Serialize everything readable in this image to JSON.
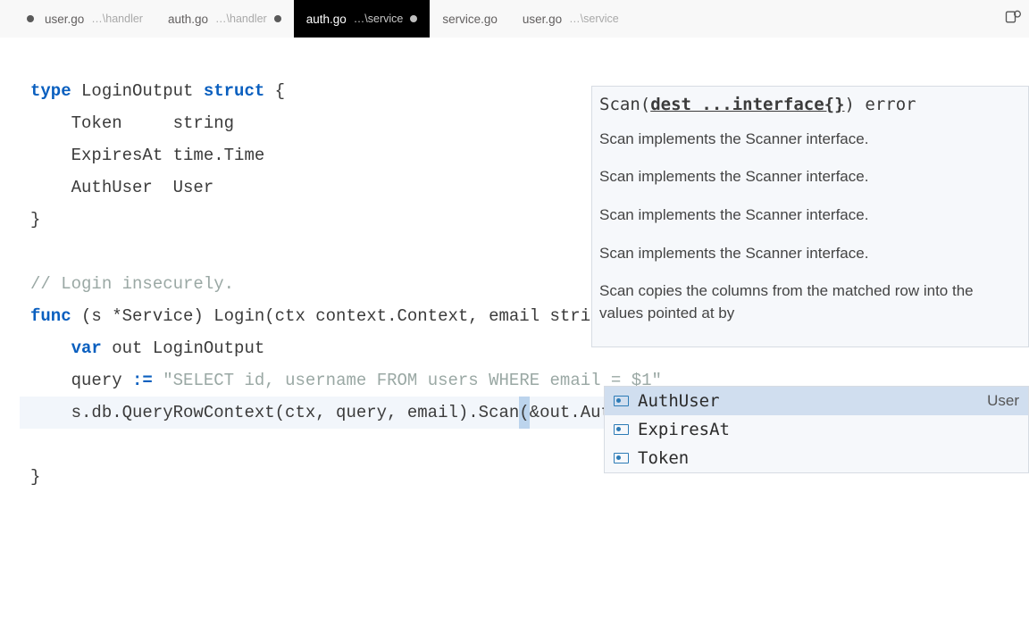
{
  "tabs": [
    {
      "name": "user.go",
      "path": "…\\handler",
      "modified": true,
      "active": false
    },
    {
      "name": "auth.go",
      "path": "…\\handler",
      "modified": true,
      "active": false
    },
    {
      "name": "auth.go",
      "path": "…\\service",
      "modified": true,
      "active": true
    },
    {
      "name": "service.go",
      "path": "",
      "modified": false,
      "active": false
    },
    {
      "name": "user.go",
      "path": "…\\service",
      "modified": false,
      "active": false
    }
  ],
  "code": {
    "l1_kw": "type",
    "l1_rest": " LoginOutput ",
    "l1_kw2": "struct",
    "l1_rest2": " {",
    "l2": "    Token     string",
    "l3": "    ExpiresAt time.Time",
    "l4": "    AuthUser  User",
    "l5": "}",
    "l6": "",
    "l7_cm": "// Login insecurely.",
    "l8_kw": "func",
    "l8_rest": " (s *Service) Login(ctx context.Context, email string) (Log",
    "l9a": "    ",
    "l9_kw": "var",
    "l9b": " out LoginOutput",
    "l10a": "    query ",
    "l10_op": ":=",
    "l10b": " ",
    "l10_str": "\"SELECT id, username FROM users WHERE email = $1\"",
    "l11a": "    s.db.QueryRowContext(ctx, query, email).Scan",
    "l11_p": "(",
    "l11b": "&out.AuthUser.ID, &out.",
    "l11c": ")",
    "l12": "}"
  },
  "signature": {
    "prefix": "Scan(",
    "param": "dest ...interface{}",
    "suffix": ") error",
    "body": [
      "Scan implements the Scanner interface.",
      "Scan implements the Scanner interface.",
      "Scan implements the Scanner interface.",
      "Scan implements the Scanner interface.",
      "Scan copies the columns from the matched row into the values pointed at by"
    ]
  },
  "autocomplete": [
    {
      "label": "AuthUser",
      "detail": "User",
      "selected": true
    },
    {
      "label": "ExpiresAt",
      "detail": "",
      "selected": false
    },
    {
      "label": "Token",
      "detail": "",
      "selected": false
    }
  ]
}
